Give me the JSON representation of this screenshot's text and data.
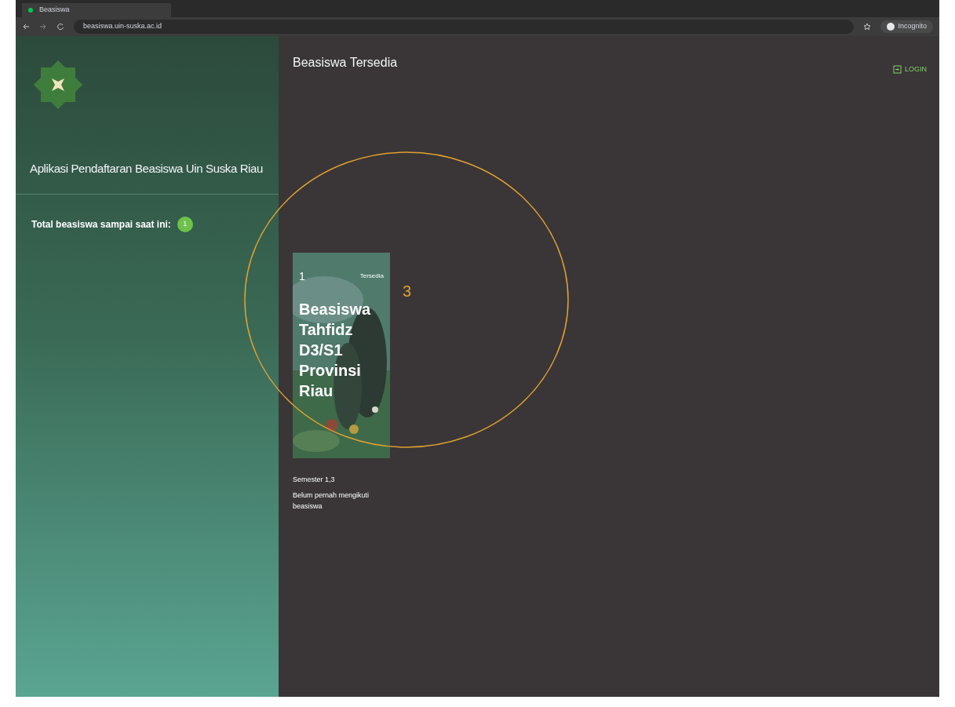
{
  "browser": {
    "tab_title": "Beasiswa",
    "url": "beasiswa.uin-suska.ac.id",
    "profile": "Incognito"
  },
  "sidebar": {
    "app_title": "Aplikasi Pendaftaran Beasiswa Uin Suska Riau",
    "total_label": "Total beasiswa sampai saat ini:",
    "total_count": "1"
  },
  "main": {
    "heading": "Beasiswa Tersedia",
    "login": "LOGIN",
    "cards": [
      {
        "number": "1",
        "status": "Tersedia",
        "title": "Beasiswa Tahfidz D3/S1 Provinsi Riau",
        "details": [
          "Semester 1,3",
          "Belum pernah mengikuti beasiswa"
        ]
      }
    ]
  },
  "annotation": {
    "label": "3"
  }
}
